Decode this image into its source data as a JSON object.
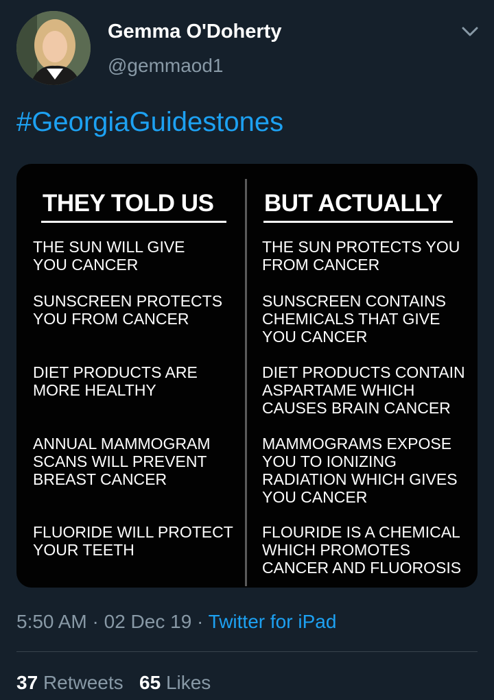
{
  "author": {
    "display_name": "Gemma O'Doherty",
    "handle": "@gemmaod1"
  },
  "tweet": {
    "hashtag": "#GeorgiaGuidestones"
  },
  "meme": {
    "left_heading": "THEY TOLD US",
    "right_heading": "BUT ACTUALLY",
    "rows": [
      {
        "left": "THE SUN WILL GIVE\nYOU CANCER",
        "right": "THE SUN PROTECTS YOU\nFROM CANCER"
      },
      {
        "left": "SUNSCREEN PROTECTS\nYOU FROM CANCER",
        "right": "SUNSCREEN CONTAINS\nCHEMICALS THAT GIVE\nYOU CANCER"
      },
      {
        "left": "DIET PRODUCTS ARE\nMORE HEALTHY",
        "right": "DIET PRODUCTS CONTAIN\nASPARTAME WHICH\nCAUSES BRAIN CANCER"
      },
      {
        "left": "ANNUAL MAMMOGRAM\nSCANS WILL PREVENT\nBREAST CANCER",
        "right": "MAMMOGRAMS EXPOSE\nYOU TO IONIZING\nRADIATION WHICH GIVES\nYOU CANCER"
      },
      {
        "left": "FLUORIDE WILL PROTECT\nYOUR TEETH",
        "right": "FLOURIDE IS A CHEMICAL\nWHICH PROMOTES\nCANCER AND FLUOROSIS"
      }
    ]
  },
  "meta": {
    "time": "5:50 AM",
    "dot1": "·",
    "date": "02 Dec 19",
    "dot2": "·",
    "source": "Twitter for iPad"
  },
  "stats": {
    "retweets_count": "37",
    "retweets_label": "Retweets",
    "likes_count": "65",
    "likes_label": "Likes"
  },
  "icons": {
    "menu": "chevron-down-icon"
  },
  "colors": {
    "background": "#15202b",
    "link": "#1da1f2",
    "secondary_text": "#8899a6"
  }
}
